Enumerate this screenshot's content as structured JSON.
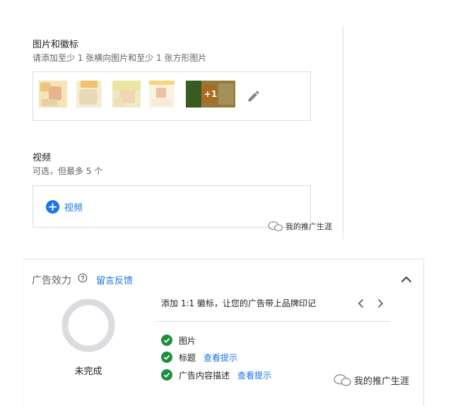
{
  "images_section": {
    "title": "图片和徽标",
    "subtitle": "请添加至少 1 张横向图片和至少 1 张方形图片",
    "more_count": "+1"
  },
  "video_section": {
    "title": "视频",
    "subtitle": "可选，但最多 5 个",
    "add_label": "视频"
  },
  "watermark_text": "我的推广生涯",
  "ad_strength": {
    "title": "广告效力",
    "feedback_link": "留言反馈",
    "status": "未完成",
    "tip": "添加 1:1 徽标，让您的广告带上品牌印记",
    "checklist": [
      {
        "label": "图片",
        "link": ""
      },
      {
        "label": "标题",
        "link": "查看提示"
      },
      {
        "label": "广告内容描述",
        "link": "查看提示"
      }
    ]
  },
  "colors": {
    "accent_blue": "#1a73e8",
    "success_green": "#1e8e3e",
    "ring_gray": "#dadce0"
  }
}
